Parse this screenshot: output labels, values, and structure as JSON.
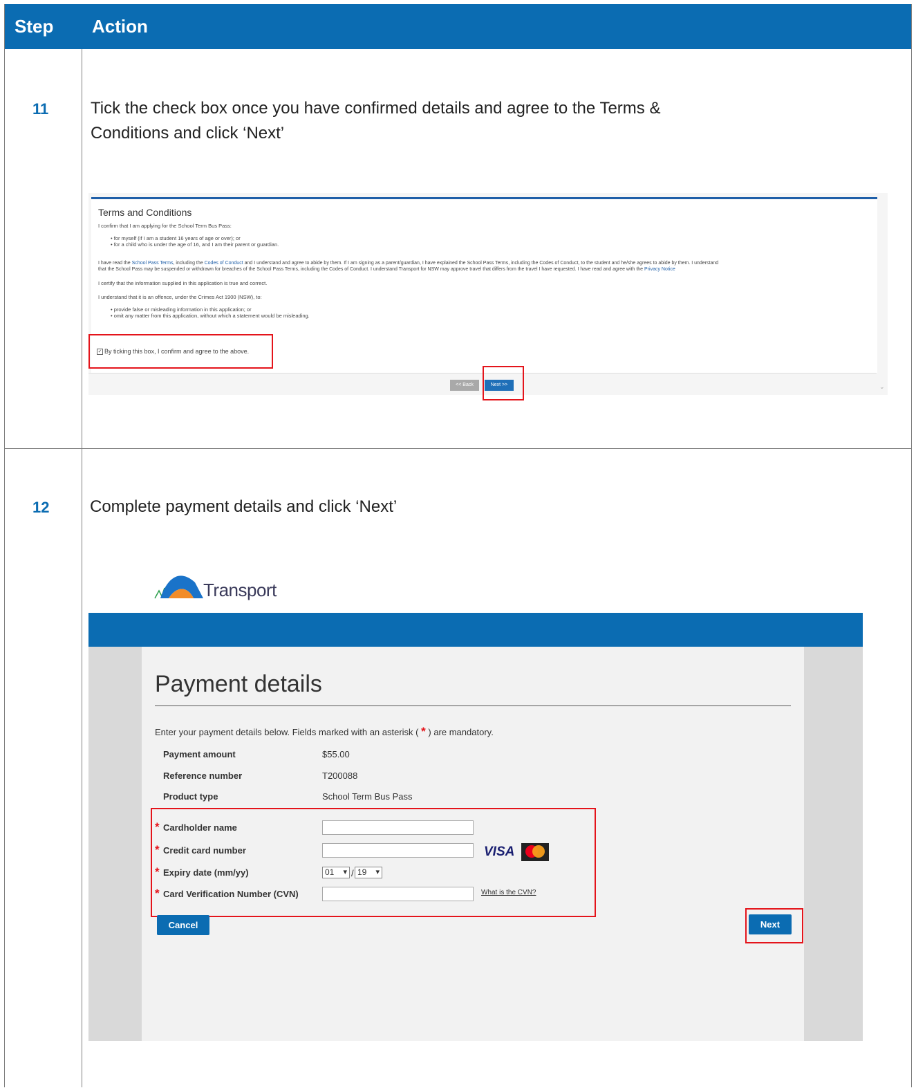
{
  "header": {
    "step": "Step",
    "action": "Action"
  },
  "step11": {
    "number": "11",
    "instruction_line1": "Tick the check box once you have confirmed details and agree to the Terms &",
    "instruction_line2": "Conditions and click ‘Next’",
    "screenshot": {
      "title": "Terms and Conditions",
      "confirm_line": "I confirm that I am applying for the School Term Bus Pass:",
      "bullet1": "for myself (if I am a student 16 years of age or over); or",
      "bullet2": "for a child who is under the age of 16, and I am their parent or guardian.",
      "read_prefix": "I have read the",
      "school_pass_terms_link": "School Pass Terms",
      "read_mid": ", including the",
      "codes_link": "Codes of Conduct",
      "read_rest": "and I understand and agree to abide by them. If I am signing as a parent/guardian, I have explained the School Pass Terms, including the Codes of Conduct, to the student and he/she agrees to abide by them. I understand",
      "read_line2": "that the School Pass may be suspended or withdrawn for breaches of the School Pass Terms, including the Codes of Conduct. I understand Transport for NSW may approve travel that differs from the travel I have requested. I have read and agree with the",
      "privacy_link": "Privacy Notice",
      "certify_line": "I certify that the information supplied in this application is true and correct.",
      "offence_line": "I understand that it is an offence, under the Crimes Act 1900 (NSW), to:",
      "offence_bullet1": "provide false or misleading information in this application; or",
      "offence_bullet2": "omit any matter from this application, without which a statement would be misleading.",
      "checkbox_label": "By ticking this box, I confirm and agree to the above.",
      "back_button": "<< Back",
      "next_button": "Next >>"
    }
  },
  "step12": {
    "number": "12",
    "instruction": "Complete payment details and click ‘Next’",
    "logo_text": "Transport",
    "form": {
      "title": "Payment details",
      "intro_prefix": "Enter your payment details below. Fields marked with an asterisk (",
      "intro_star": "*",
      "intro_suffix": ") are mandatory.",
      "payment_amount_label": "Payment amount",
      "payment_amount_value": "$55.00",
      "reference_number_label": "Reference number",
      "reference_number_value": "T200088",
      "product_type_label": "Product type",
      "product_type_value": "School Term Bus Pass",
      "required_marker": "*",
      "cardholder_label": "Cardholder name",
      "card_number_label": "Credit card number",
      "expiry_label": "Expiry date (mm/yy)",
      "expiry_month": "01",
      "expiry_year": "19",
      "expiry_separator": "/",
      "cvn_label": "Card Verification Number (CVN)",
      "cvn_link": "What is the CVN?",
      "visa_text": "VISA",
      "cancel_button": "Cancel",
      "next_button": "Next"
    }
  },
  "colors": {
    "brand_blue": "#0b6cb2",
    "highlight_red": "#e4141b"
  }
}
